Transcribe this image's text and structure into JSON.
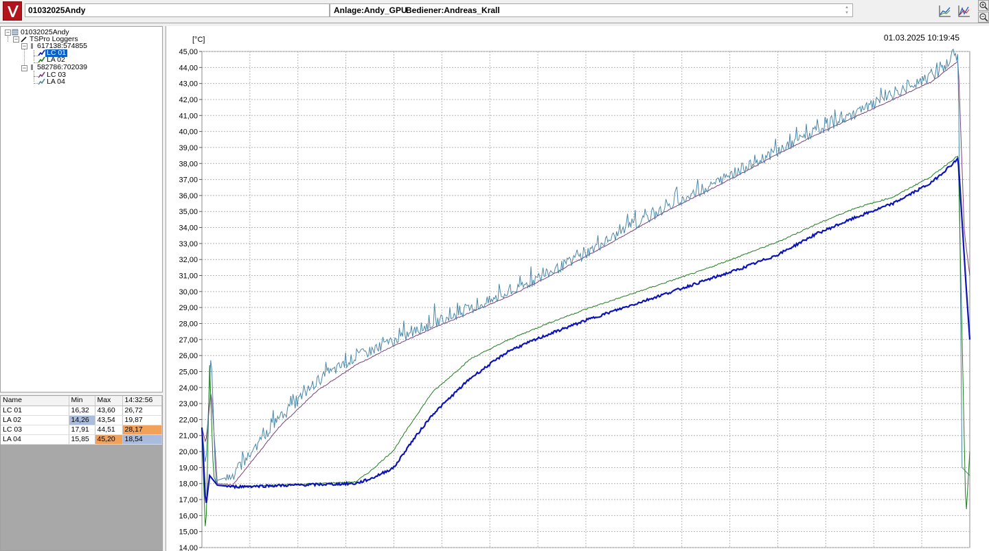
{
  "header": {
    "title": "01032025Andy",
    "plant": "Anlage:Andy_GPU",
    "operator": "Bediener:Andreas_Krall"
  },
  "tree": {
    "root": "01032025Andy",
    "group": "TSPro Loggers",
    "loggers": [
      {
        "id": "617138:574855",
        "channels": [
          "LC 01",
          "LA 02"
        ]
      },
      {
        "id": "582786:702039",
        "channels": [
          "LC 03",
          "LA 04"
        ]
      }
    ],
    "selected": "LC 01"
  },
  "table": {
    "headers": [
      "Name",
      "Min",
      "Max",
      "14:32:56"
    ],
    "rows": [
      {
        "name": "LC 01",
        "min": "16,32",
        "max": "43,60",
        "cur": "26,72"
      },
      {
        "name": "LA 02",
        "min": "14,26",
        "max": "43,54",
        "cur": "19,87"
      },
      {
        "name": "LC 03",
        "min": "17,91",
        "max": "44,51",
        "cur": "28,17"
      },
      {
        "name": "LA 04",
        "min": "15,85",
        "max": "45,20",
        "cur": "18,54"
      }
    ]
  },
  "colors": {
    "lc01": "#0a12b8",
    "la02": "#1e7b1e",
    "lc03": "#7a3d7a",
    "la04": "#4a86a8",
    "highlight_blue": "#a9bcdd",
    "highlight_orange": "#f2a15a",
    "logo": "#b3141c"
  },
  "chart": {
    "unit": "[°C]",
    "timestamp": "01.03.2025 10:19:45"
  },
  "chart_data": {
    "type": "line",
    "ylim": [
      14.0,
      45.0
    ],
    "y_ticks": [
      "14,00",
      "15,00",
      "16,00",
      "17,00",
      "18,00",
      "19,00",
      "20,00",
      "21,00",
      "22,00",
      "23,00",
      "24,00",
      "25,00",
      "26,00",
      "27,00",
      "28,00",
      "29,00",
      "30,00",
      "31,00",
      "32,00",
      "33,00",
      "34,00",
      "35,00",
      "36,00",
      "37,00",
      "38,00",
      "39,00",
      "40,00",
      "41,00",
      "42,00",
      "43,00",
      "44,00",
      "45,00"
    ],
    "x_gridlines": 16,
    "grid": true,
    "series": [
      {
        "name": "LC 01",
        "x": [
          0,
          0.005,
          0.01,
          0.02,
          0.04,
          0.2,
          0.22,
          0.25,
          0.27,
          0.3,
          0.35,
          0.4,
          0.45,
          0.5,
          0.55,
          0.6,
          0.65,
          0.7,
          0.75,
          0.8,
          0.85,
          0.9,
          0.95,
          0.985,
          0.995,
          1.0
        ],
        "y": [
          21.5,
          16.5,
          18.5,
          17.9,
          17.8,
          18.0,
          18.3,
          19.0,
          20.4,
          22.3,
          24.6,
          26.3,
          27.3,
          28.2,
          29.0,
          29.8,
          30.6,
          31.4,
          32.3,
          33.6,
          34.6,
          35.5,
          36.8,
          38.3,
          30.5,
          27.0
        ]
      },
      {
        "name": "LA 02",
        "x": [
          0,
          0.005,
          0.01,
          0.015,
          0.02,
          0.04,
          0.2,
          0.22,
          0.25,
          0.27,
          0.3,
          0.35,
          0.4,
          0.45,
          0.5,
          0.55,
          0.6,
          0.65,
          0.7,
          0.75,
          0.8,
          0.85,
          0.9,
          0.95,
          0.985,
          0.995,
          1.0
        ],
        "y": [
          21.0,
          14.4,
          25.4,
          18.5,
          17.9,
          17.8,
          18.1,
          18.8,
          20.1,
          21.6,
          23.7,
          25.8,
          27.0,
          28.0,
          28.9,
          29.7,
          30.5,
          31.3,
          32.2,
          33.1,
          34.2,
          35.2,
          35.9,
          37.2,
          38.5,
          15.8,
          20.0
        ]
      },
      {
        "name": "LC 03",
        "x": [
          0,
          0.005,
          0.012,
          0.02,
          0.04,
          0.1,
          0.15,
          0.2,
          0.25,
          0.3,
          0.35,
          0.4,
          0.45,
          0.5,
          0.55,
          0.6,
          0.65,
          0.7,
          0.75,
          0.8,
          0.85,
          0.9,
          0.95,
          0.985,
          0.993,
          1.0
        ],
        "y": [
          21.5,
          20.5,
          23.9,
          18.0,
          17.9,
          21.5,
          23.8,
          25.4,
          26.6,
          27.7,
          28.7,
          29.7,
          30.9,
          32.2,
          33.5,
          34.9,
          36.1,
          37.3,
          38.6,
          39.8,
          40.9,
          42.0,
          43.1,
          44.4,
          33.7,
          31.0
        ]
      },
      {
        "name": "LA 04",
        "x": [
          0,
          0.005,
          0.012,
          0.018,
          0.02,
          0.04,
          0.1,
          0.15,
          0.2,
          0.25,
          0.3,
          0.35,
          0.4,
          0.45,
          0.5,
          0.55,
          0.6,
          0.65,
          0.7,
          0.75,
          0.8,
          0.85,
          0.9,
          0.95,
          0.985,
          0.99,
          1.0
        ],
        "y": [
          21.5,
          19.0,
          26.3,
          18.0,
          18.2,
          18.5,
          22.0,
          24.4,
          25.9,
          26.9,
          28.0,
          28.9,
          29.9,
          31.1,
          32.4,
          33.8,
          35.1,
          36.3,
          37.6,
          38.8,
          40.0,
          41.1,
          42.3,
          43.4,
          44.8,
          19.0,
          18.5
        ]
      }
    ]
  }
}
